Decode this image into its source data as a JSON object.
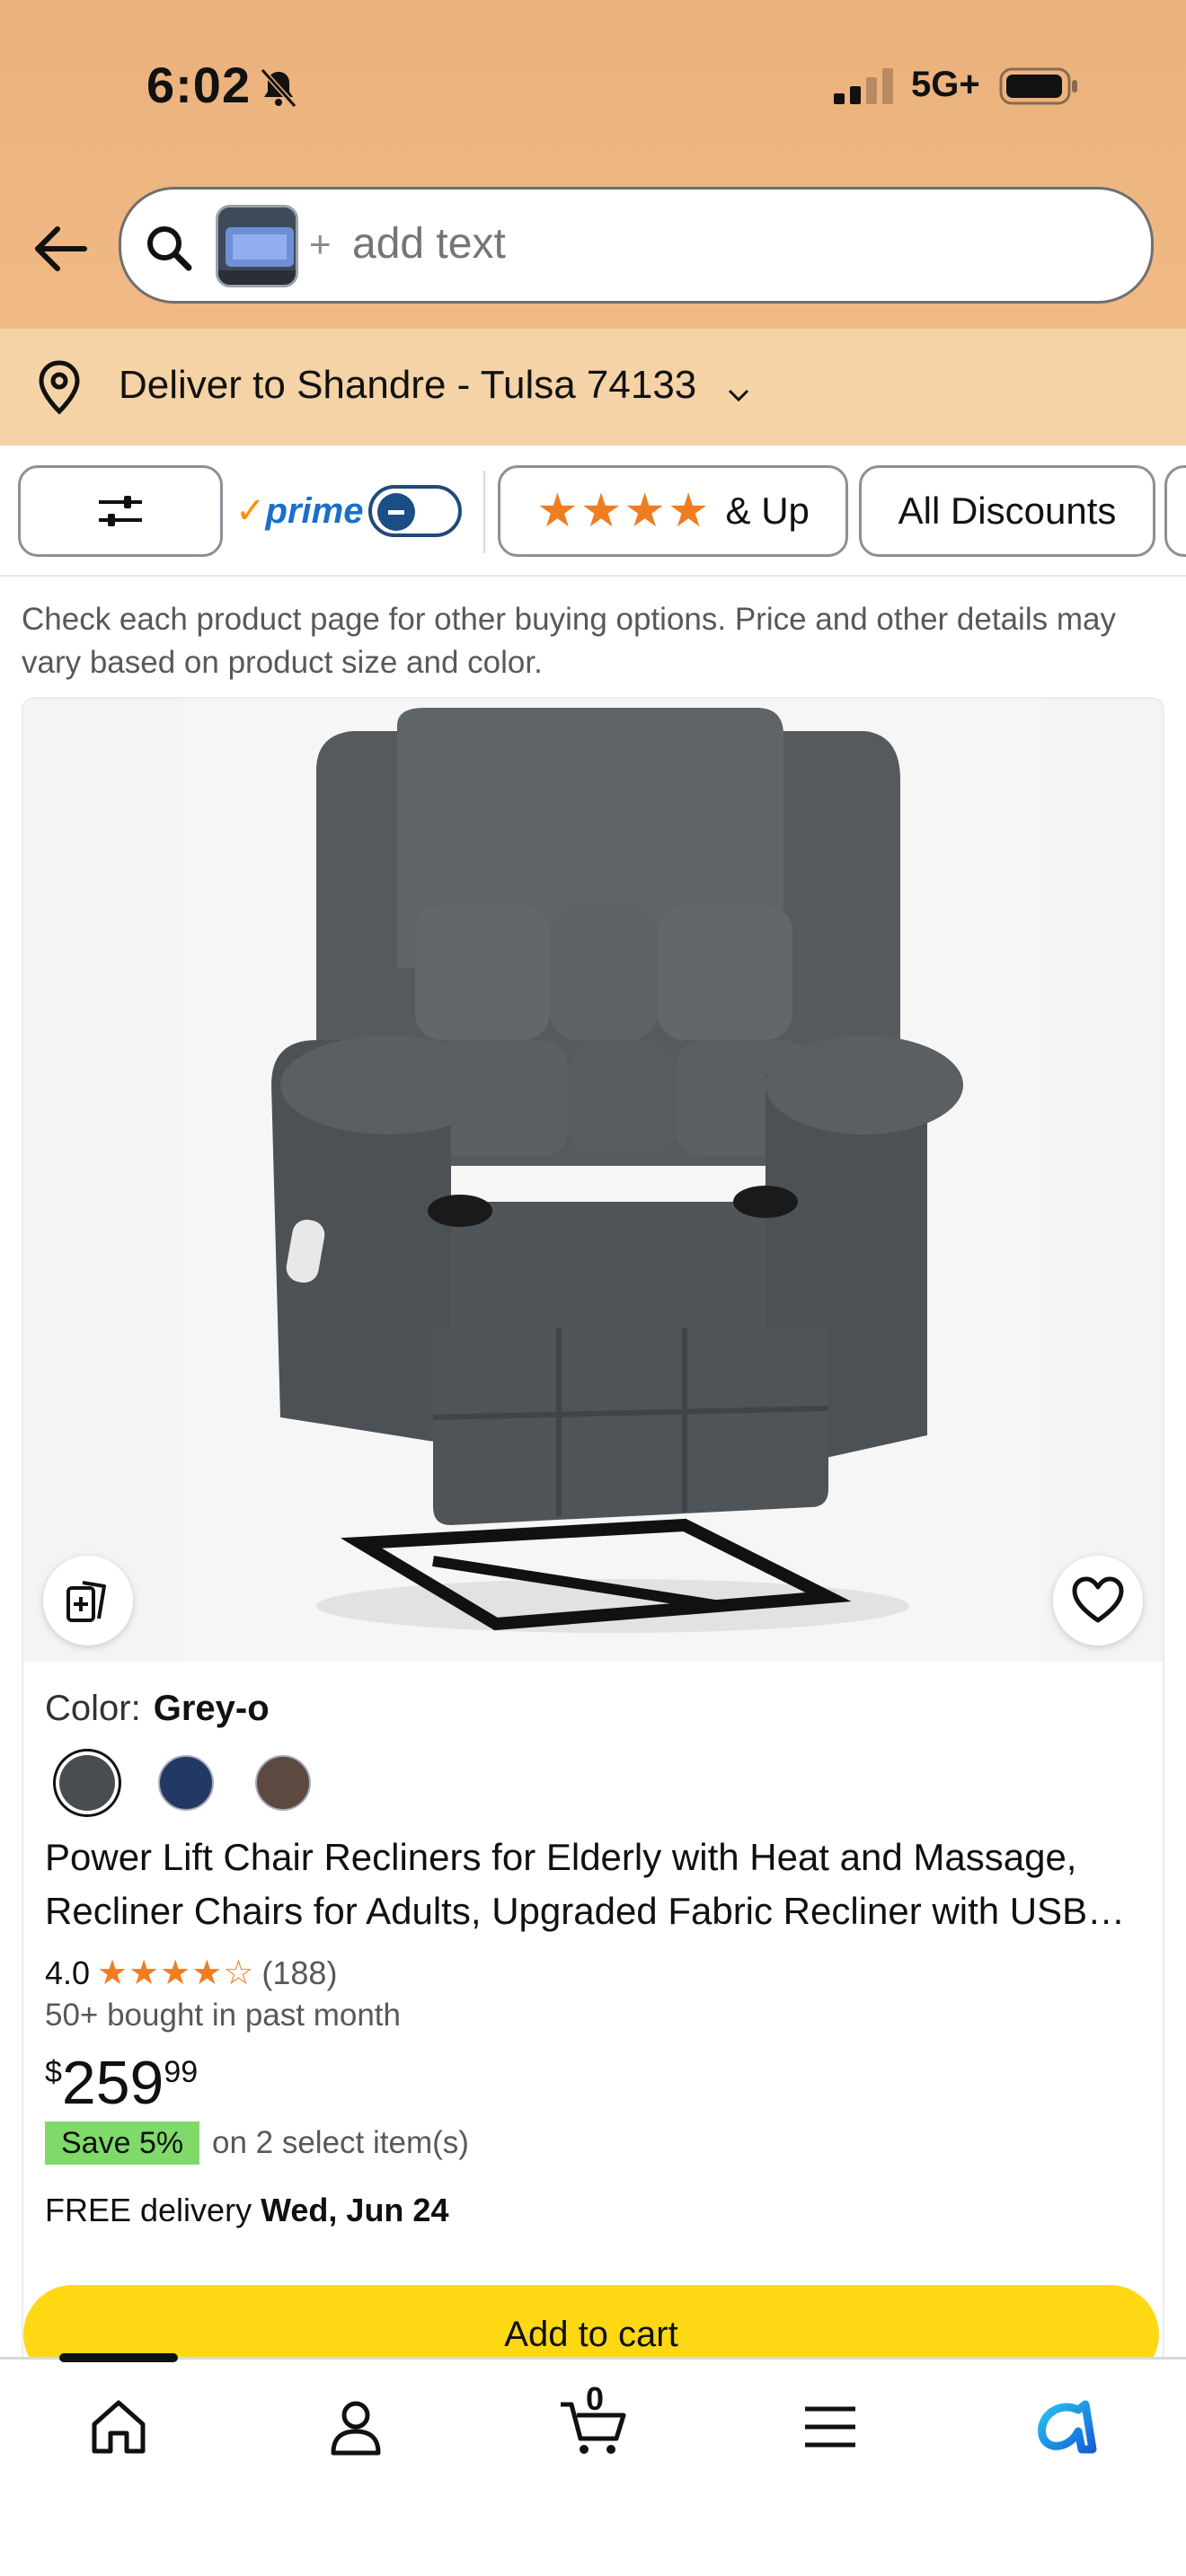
{
  "status_bar": {
    "time": "6:02",
    "network": "5G+"
  },
  "search": {
    "placeholder": "add text",
    "plus": "+"
  },
  "deliver": {
    "text": "Deliver to Shandre - Tulsa 74133"
  },
  "filters": {
    "prime_label": "prime",
    "prime_check": "✓",
    "rating_stars": "★★★★",
    "rating_label": "& Up",
    "discounts_label": "All Discounts"
  },
  "notice": "Check each product page for other buying options. Price and other details may vary based on product size and color.",
  "product": {
    "color_label": "Color:",
    "color_value": "Grey-o",
    "swatches": [
      "#4a4d50",
      "#223a63",
      "#5c4a40"
    ],
    "title": "Power Lift Chair Recliners for Elderly with Heat and Massage, Recliner Chairs for Adults, Upgraded Fabric Recliner with USB Ports and Cup Holders",
    "rating_value": "4.0",
    "rating_stars": "★★★★☆",
    "rating_count": "(188)",
    "bought": "50+ bought in past month",
    "price_symbol": "$",
    "price_whole": "259",
    "price_fraction": "99",
    "save_badge": "Save 5%",
    "save_text": "on 2 select item(s)",
    "delivery_prefix": "FREE delivery",
    "delivery_date": "Wed, Jun 24",
    "add_to_cart": "Add to cart"
  },
  "bottom_nav": {
    "cart_count": "0"
  },
  "colors": {
    "header_bg": "#ebb17c",
    "deliver_bg": "#f5d3a6",
    "add_to_cart": "#ffd814",
    "save_badge": "#7fda69",
    "star": "#ef7d22",
    "prime_blue": "#1a6fc9"
  }
}
